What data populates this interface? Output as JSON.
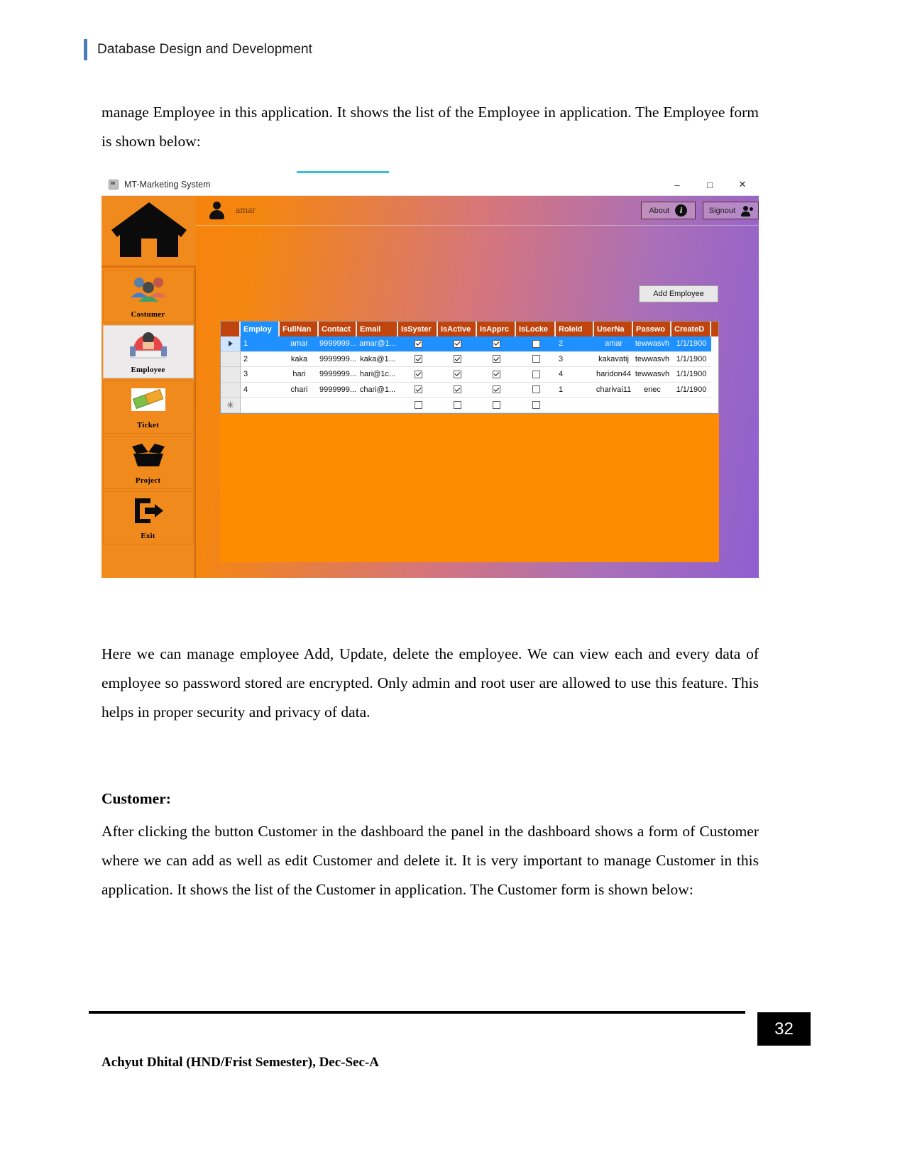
{
  "header": {
    "title": "Database Design and Development"
  },
  "paragraphs": {
    "intro": "manage Employee in this application. It shows the list of the Employee in application. The Employee form is shown below:",
    "after_figure": "Here we can manage employee Add, Update, delete the employee. We can view each and every data of employee so password stored are encrypted. Only admin and root user are allowed to use this feature. This helps in proper security and privacy of data.",
    "customer_heading": "Customer:",
    "customer_body": "After clicking the button Customer in the dashboard the panel in the dashboard shows a form of Customer where we can add as well as edit Customer and delete it. It is very important to manage Customer in this application. It shows the list of the Customer in application. The Customer form is shown below:"
  },
  "figure": {
    "window": {
      "title": "MT-Marketing System",
      "minimize": "–",
      "maximize": "□",
      "close": "✕"
    },
    "topbar": {
      "user": "amar",
      "about_label": "About",
      "signout_label": "Signout"
    },
    "add_button": "Add Employee",
    "sidebar": [
      {
        "label": "",
        "icon": "home-icon",
        "active": false
      },
      {
        "label": "Costumer",
        "icon": "customers-icon",
        "active": false
      },
      {
        "label": "Employee",
        "icon": "employee-icon",
        "active": true
      },
      {
        "label": "Ticket",
        "icon": "ticket-icon",
        "active": false
      },
      {
        "label": "Project",
        "icon": "project-box-icon",
        "active": false
      },
      {
        "label": "Exit",
        "icon": "exit-icon",
        "active": false
      }
    ],
    "grid": {
      "columns": [
        "EmployeeId",
        "FullName",
        "Contact",
        "Email",
        "IsSystem",
        "IsActive",
        "IsApproved",
        "IsLocked",
        "RoleId",
        "UserName",
        "Password",
        "CreatedDate"
      ],
      "columns_display": [
        "Employ",
        "FullNan",
        "Contact",
        "Email",
        "IsSyster",
        "IsActive",
        "IsApprc",
        "IsLocke",
        "RoleId",
        "UserNa",
        "Passwo",
        "CreateD"
      ],
      "rows": [
        {
          "id": "1",
          "fullname": "amar",
          "contact": "9999999...",
          "email": "amar@1...",
          "issystem": true,
          "isactive": true,
          "isapproved": true,
          "islocked": false,
          "roleid": "2",
          "username": "amar",
          "password": "tewwasvh",
          "created": "1/1/1900",
          "selected": true
        },
        {
          "id": "2",
          "fullname": "kaka",
          "contact": "9999999...",
          "email": "kaka@1...",
          "issystem": true,
          "isactive": true,
          "isapproved": true,
          "islocked": false,
          "roleid": "3",
          "username": "kakavatij",
          "password": "tewwasvh",
          "created": "1/1/1900",
          "selected": false
        },
        {
          "id": "3",
          "fullname": "hari",
          "contact": "9999999...",
          "email": "hari@1c...",
          "issystem": true,
          "isactive": true,
          "isapproved": true,
          "islocked": false,
          "roleid": "4",
          "username": "haridon44",
          "password": "tewwasvh",
          "created": "1/1/1900",
          "selected": false
        },
        {
          "id": "4",
          "fullname": "chari",
          "contact": "9999999...",
          "email": "chari@1...",
          "issystem": true,
          "isactive": true,
          "isapproved": true,
          "islocked": false,
          "roleid": "1",
          "username": "charivai11",
          "password": "enec",
          "created": "1/1/1900",
          "selected": false
        }
      ],
      "new_row": {
        "id": "",
        "fullname": "",
        "contact": "",
        "email": "",
        "issystem": false,
        "isactive": false,
        "isapproved": false,
        "islocked": false,
        "roleid": "",
        "username": "",
        "password": "",
        "created": ""
      }
    }
  },
  "footer": {
    "author": "Achyut Dhital (HND/Frist Semester), Dec-Sec-A",
    "page_number": "32"
  },
  "colors": {
    "accent_blue": "#4a7ebb",
    "grid_header": "#c0440d",
    "selection": "#1e90ff",
    "app_orange": "#f08a1c",
    "canvas_orange": "#ff8c00"
  }
}
